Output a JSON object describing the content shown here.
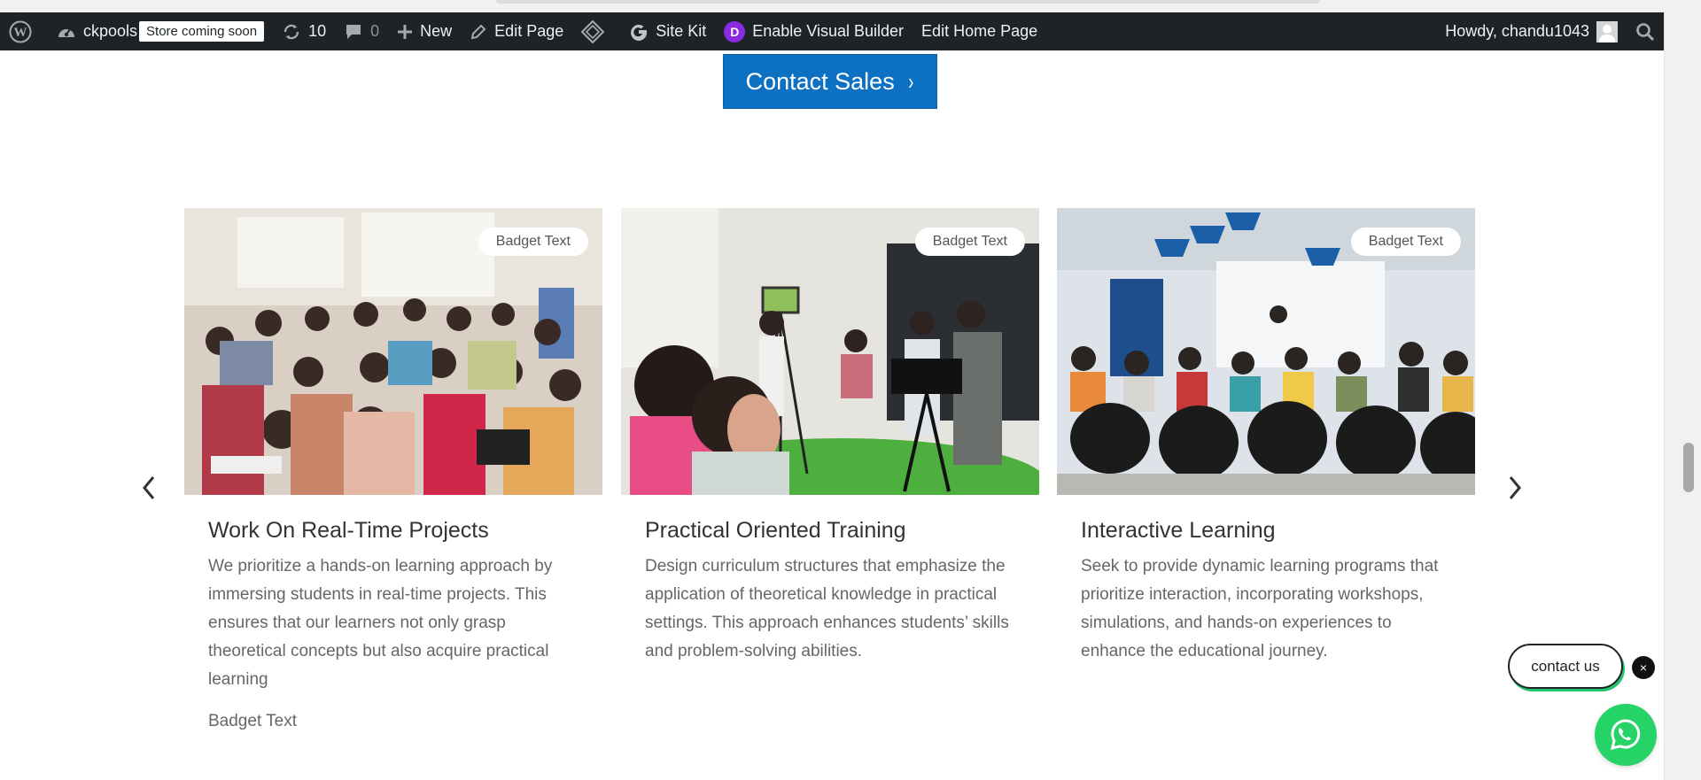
{
  "adminbar": {
    "site_name": "ckpools",
    "store_badge": "Store coming soon",
    "updates_count": "10",
    "comments_count": "0",
    "new_label": "New",
    "edit_page_label": "Edit Page",
    "site_kit_label": "Site Kit",
    "visual_builder_label": "Enable Visual Builder",
    "edit_home_label": "Edit Home Page",
    "howdy_label": "Howdy, chandu1043",
    "divi_letter": "D"
  },
  "hero": {
    "contact_sales_label": "Contact Sales",
    "contact_sales_chevron": "›"
  },
  "carousel": {
    "prev_symbol": "‹",
    "next_symbol": "›",
    "cards": [
      {
        "badge": "Badget Text",
        "title": "Work On Real-Time Projects",
        "body": "We prioritize a hands-on learning approach by immersing students in real-time projects. This ensures that our learners not only grasp theoretical concepts but also acquire practical learning",
        "footer": "Badget Text"
      },
      {
        "badge": "Badget Text",
        "title": "Practical Oriented Training",
        "body": "Design curriculum structures that emphasize the application of theoretical knowledge in practical settings. This approach enhances students’ skills and problem-solving abilities."
      },
      {
        "badge": "Badget Text",
        "title": "Interactive Learning",
        "body": "Seek to provide dynamic learning programs that prioritize interaction, incorporating workshops, simulations, and hands-on experiences to enhance the educational journey."
      }
    ]
  },
  "widgets": {
    "contact_us_label": "contact us",
    "close_symbol": "×"
  },
  "colors": {
    "adminbar_bg": "#1d2327",
    "button_blue": "#0c71c3",
    "whatsapp_green": "#25d366"
  }
}
